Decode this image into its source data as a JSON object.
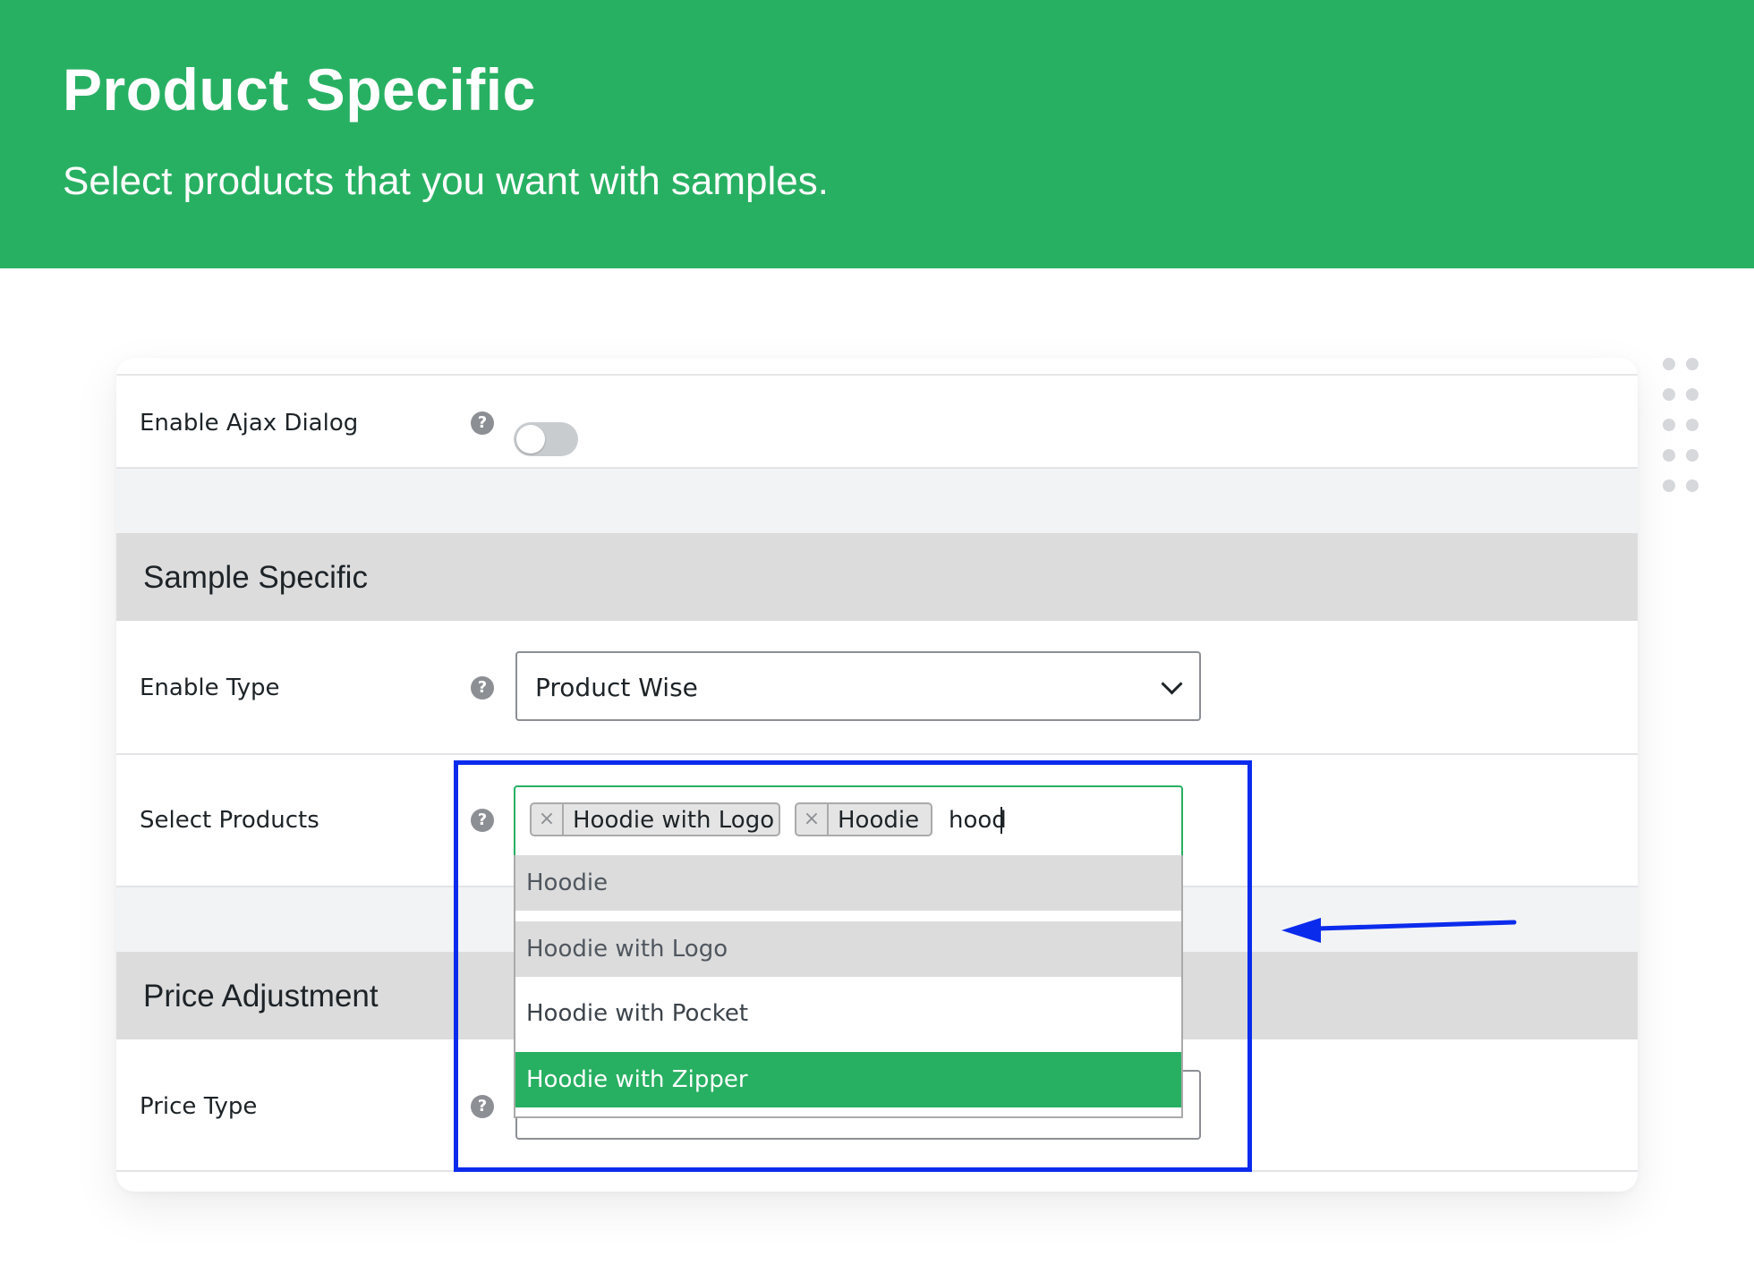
{
  "banner": {
    "title": "Product Specific",
    "subtitle": "Select products that you want with samples."
  },
  "colors": {
    "brand_green": "#28b062",
    "highlight_blue": "#0b2bec",
    "section_gray": "#dcdcdd"
  },
  "settings": {
    "ajax_dialog": {
      "label": "Enable Ajax Dialog",
      "enabled": false
    },
    "sample_specific": {
      "title": "Sample Specific",
      "enable_type": {
        "label": "Enable Type",
        "value": "Product Wise"
      },
      "select_products": {
        "label": "Select Products",
        "selected": [
          "Hoodie with Logo",
          "Hoodie"
        ],
        "search_text": "hood",
        "options": [
          "Hoodie",
          "Hoodie with Logo",
          "Hoodie with Pocket",
          "Hoodie with Zipper"
        ],
        "highlighted_option": "Hoodie with Zipper"
      }
    },
    "price_adjustment": {
      "title": "Price Adjustment",
      "price_type": {
        "label": "Price Type",
        "value": ""
      }
    }
  },
  "icons": {
    "help": "question-circle-icon",
    "remove": "close-icon",
    "dropdown": "chevron-down-icon",
    "decor": "dot-grid",
    "annotation": "arrow-left-icon"
  },
  "help_glyph": "?",
  "remove_glyph": "×"
}
